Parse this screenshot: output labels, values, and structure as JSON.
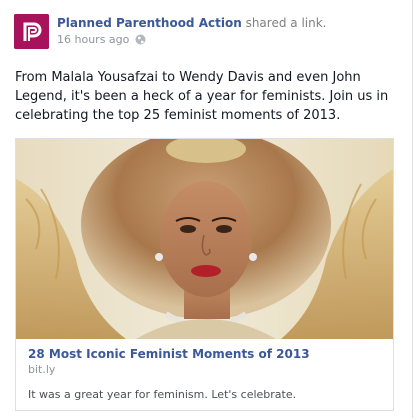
{
  "post": {
    "author": "Planned Parenthood Action",
    "action": "shared a link.",
    "timestamp": "16 hours ago",
    "privacy_icon": "globe-icon",
    "text": "From Malala Yousafzai to Wendy Davis and even John Legend, it's been a heck of a year for feminists. Join us in celebrating the top 25 feminist moments of 2013."
  },
  "link": {
    "title": "28 Most Iconic Feminist Moments of 2013",
    "domain": "bit.ly",
    "description": "It was a great year for feminism. Let's celebrate."
  },
  "colors": {
    "brand": "#a8125c",
    "link": "#3b5998"
  }
}
